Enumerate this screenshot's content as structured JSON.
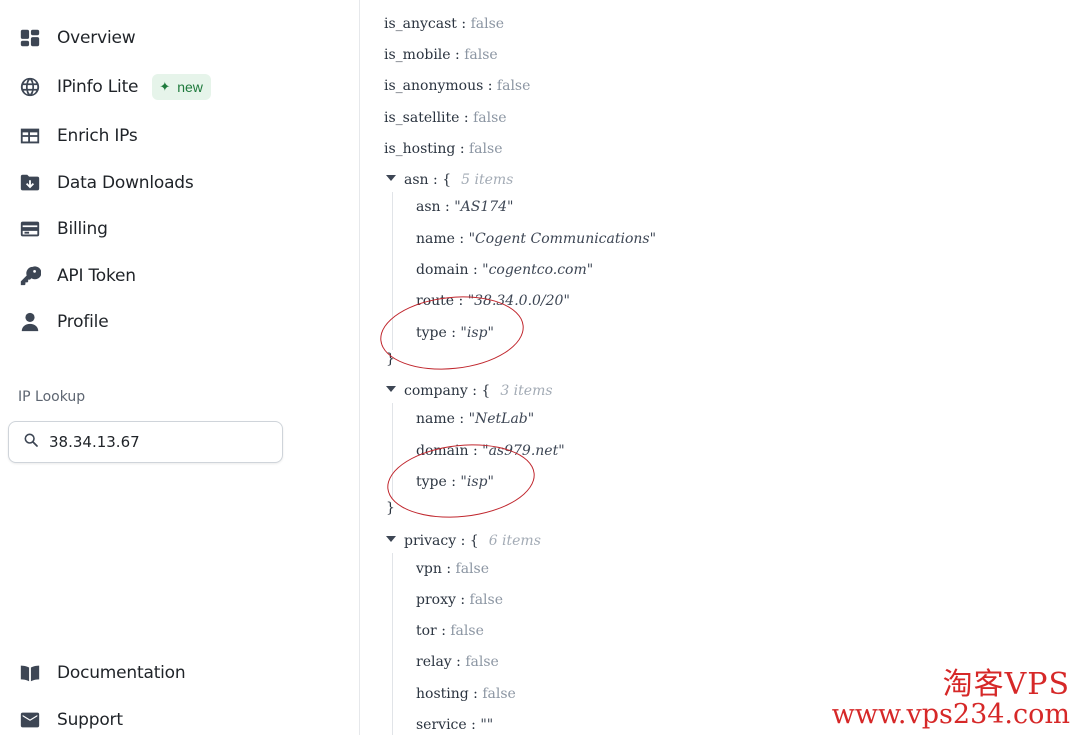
{
  "sidebar": {
    "nav_items": [
      {
        "label": "Overview",
        "icon": "overview-icon"
      },
      {
        "label": "IPinfo Lite",
        "icon": "globe-icon",
        "badge": "new"
      },
      {
        "label": "Enrich IPs",
        "icon": "table-icon"
      },
      {
        "label": "Data Downloads",
        "icon": "folder-download-icon"
      },
      {
        "label": "Billing",
        "icon": "credit-card-icon"
      },
      {
        "label": "API Token",
        "icon": "key-icon"
      },
      {
        "label": "Profile",
        "icon": "user-icon"
      }
    ],
    "lookup_title": "IP Lookup",
    "lookup_value": "38.34.13.67",
    "bottom_items": [
      {
        "label": "Documentation",
        "icon": "book-icon"
      },
      {
        "label": "Support",
        "icon": "mail-icon"
      }
    ]
  },
  "json": {
    "top": [
      {
        "key": "is_anycast",
        "value": "false"
      },
      {
        "key": "is_mobile",
        "value": "false"
      },
      {
        "key": "is_anonymous",
        "value": "false"
      },
      {
        "key": "is_satellite",
        "value": "false"
      },
      {
        "key": "is_hosting",
        "value": "false"
      }
    ],
    "asn": {
      "key": "asn",
      "count": "5 items",
      "fields": [
        {
          "key": "asn",
          "value": "\"AS174\""
        },
        {
          "key": "name",
          "value": "\"Cogent Communications\""
        },
        {
          "key": "domain",
          "value": "\"cogentco.com\""
        },
        {
          "key": "route",
          "value": "\"38.34.0.0/20\""
        },
        {
          "key": "type",
          "value": "\"isp\""
        }
      ]
    },
    "company": {
      "key": "company",
      "count": "3 items",
      "fields": [
        {
          "key": "name",
          "value": "\"NetLab\""
        },
        {
          "key": "domain",
          "value": "\"as979.net\""
        },
        {
          "key": "type",
          "value": "\"isp\""
        }
      ]
    },
    "privacy": {
      "key": "privacy",
      "count": "6 items",
      "fields": [
        {
          "key": "vpn",
          "value": "false"
        },
        {
          "key": "proxy",
          "value": "false"
        },
        {
          "key": "tor",
          "value": "false"
        },
        {
          "key": "relay",
          "value": "false"
        },
        {
          "key": "hosting",
          "value": "false"
        },
        {
          "key": "service",
          "value": "\"\""
        }
      ]
    },
    "separator": ":",
    "open_brace": "{",
    "close_brace": "}"
  },
  "watermark": {
    "line1": "淘客VPS",
    "line2": "www.vps234.com"
  },
  "colors": {
    "annotation": "#c0262d",
    "badge_bg": "#e6f4ea",
    "badge_fg": "#1e7a3c",
    "watermark": "#d62828"
  }
}
